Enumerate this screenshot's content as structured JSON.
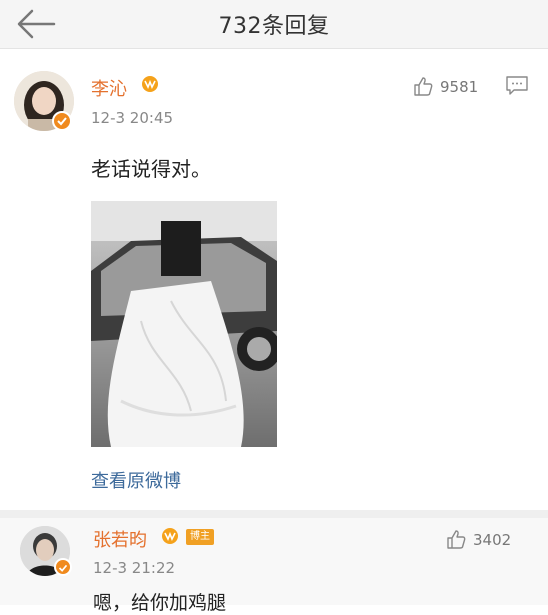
{
  "header": {
    "title": "732条回复",
    "back_icon": "arrow-left-icon"
  },
  "comments": [
    {
      "user": "李沁",
      "time": "12-3 20:45",
      "likes": "9581",
      "text": "老话说得对。",
      "link": "查看原微博",
      "vip_color": "#f5a21b",
      "verified_color": "#f08a1e"
    },
    {
      "user": "张若昀",
      "host_tag": "博主",
      "time": "12-3 21:22",
      "likes": "3402",
      "text": "嗯，给你加鸡腿"
    }
  ],
  "colors": {
    "username": "#e4712e",
    "link": "#3d6a9b",
    "muted": "#888888"
  }
}
